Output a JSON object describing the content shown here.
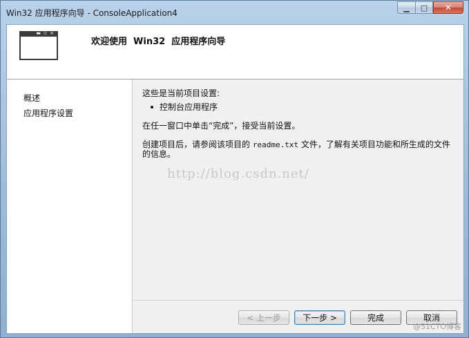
{
  "window": {
    "title": "Win32 应用程序向导 - ConsoleApplication4",
    "controls": {
      "minimize_glyph": "▁",
      "maximize_glyph": "□",
      "close_glyph": "✕"
    }
  },
  "header": {
    "title": "欢迎使用  Win32  应用程序向导",
    "icon": "window-icon",
    "icon_controls": "▬ ▫ ×"
  },
  "sidebar": {
    "items": [
      {
        "label": "概述"
      },
      {
        "label": "应用程序设置"
      }
    ]
  },
  "content": {
    "settings_heading": "这些是当前项目设置:",
    "bullet": "控制台应用程序",
    "finish_hint": "在任一窗口中单击“完成”，接受当前设置。",
    "readme_line1_a": "创建项目后，请参阅该项目的 ",
    "readme_file": "readme.txt",
    "readme_line1_b": " 文件，了解有关项目功能和所生成的文件",
    "readme_line2": "的信息。",
    "watermark": "http://blog.csdn.net/"
  },
  "footer": {
    "back_label": "< 上一步",
    "next_label": "下一步 >",
    "finish_label": "完成",
    "cancel_label": "取消"
  },
  "corner_watermark": "@51CTO博客",
  "colors": {
    "accent_default_button": "#3c7fb1",
    "close_button": "#c54a35",
    "frame": "#9cbad8"
  }
}
